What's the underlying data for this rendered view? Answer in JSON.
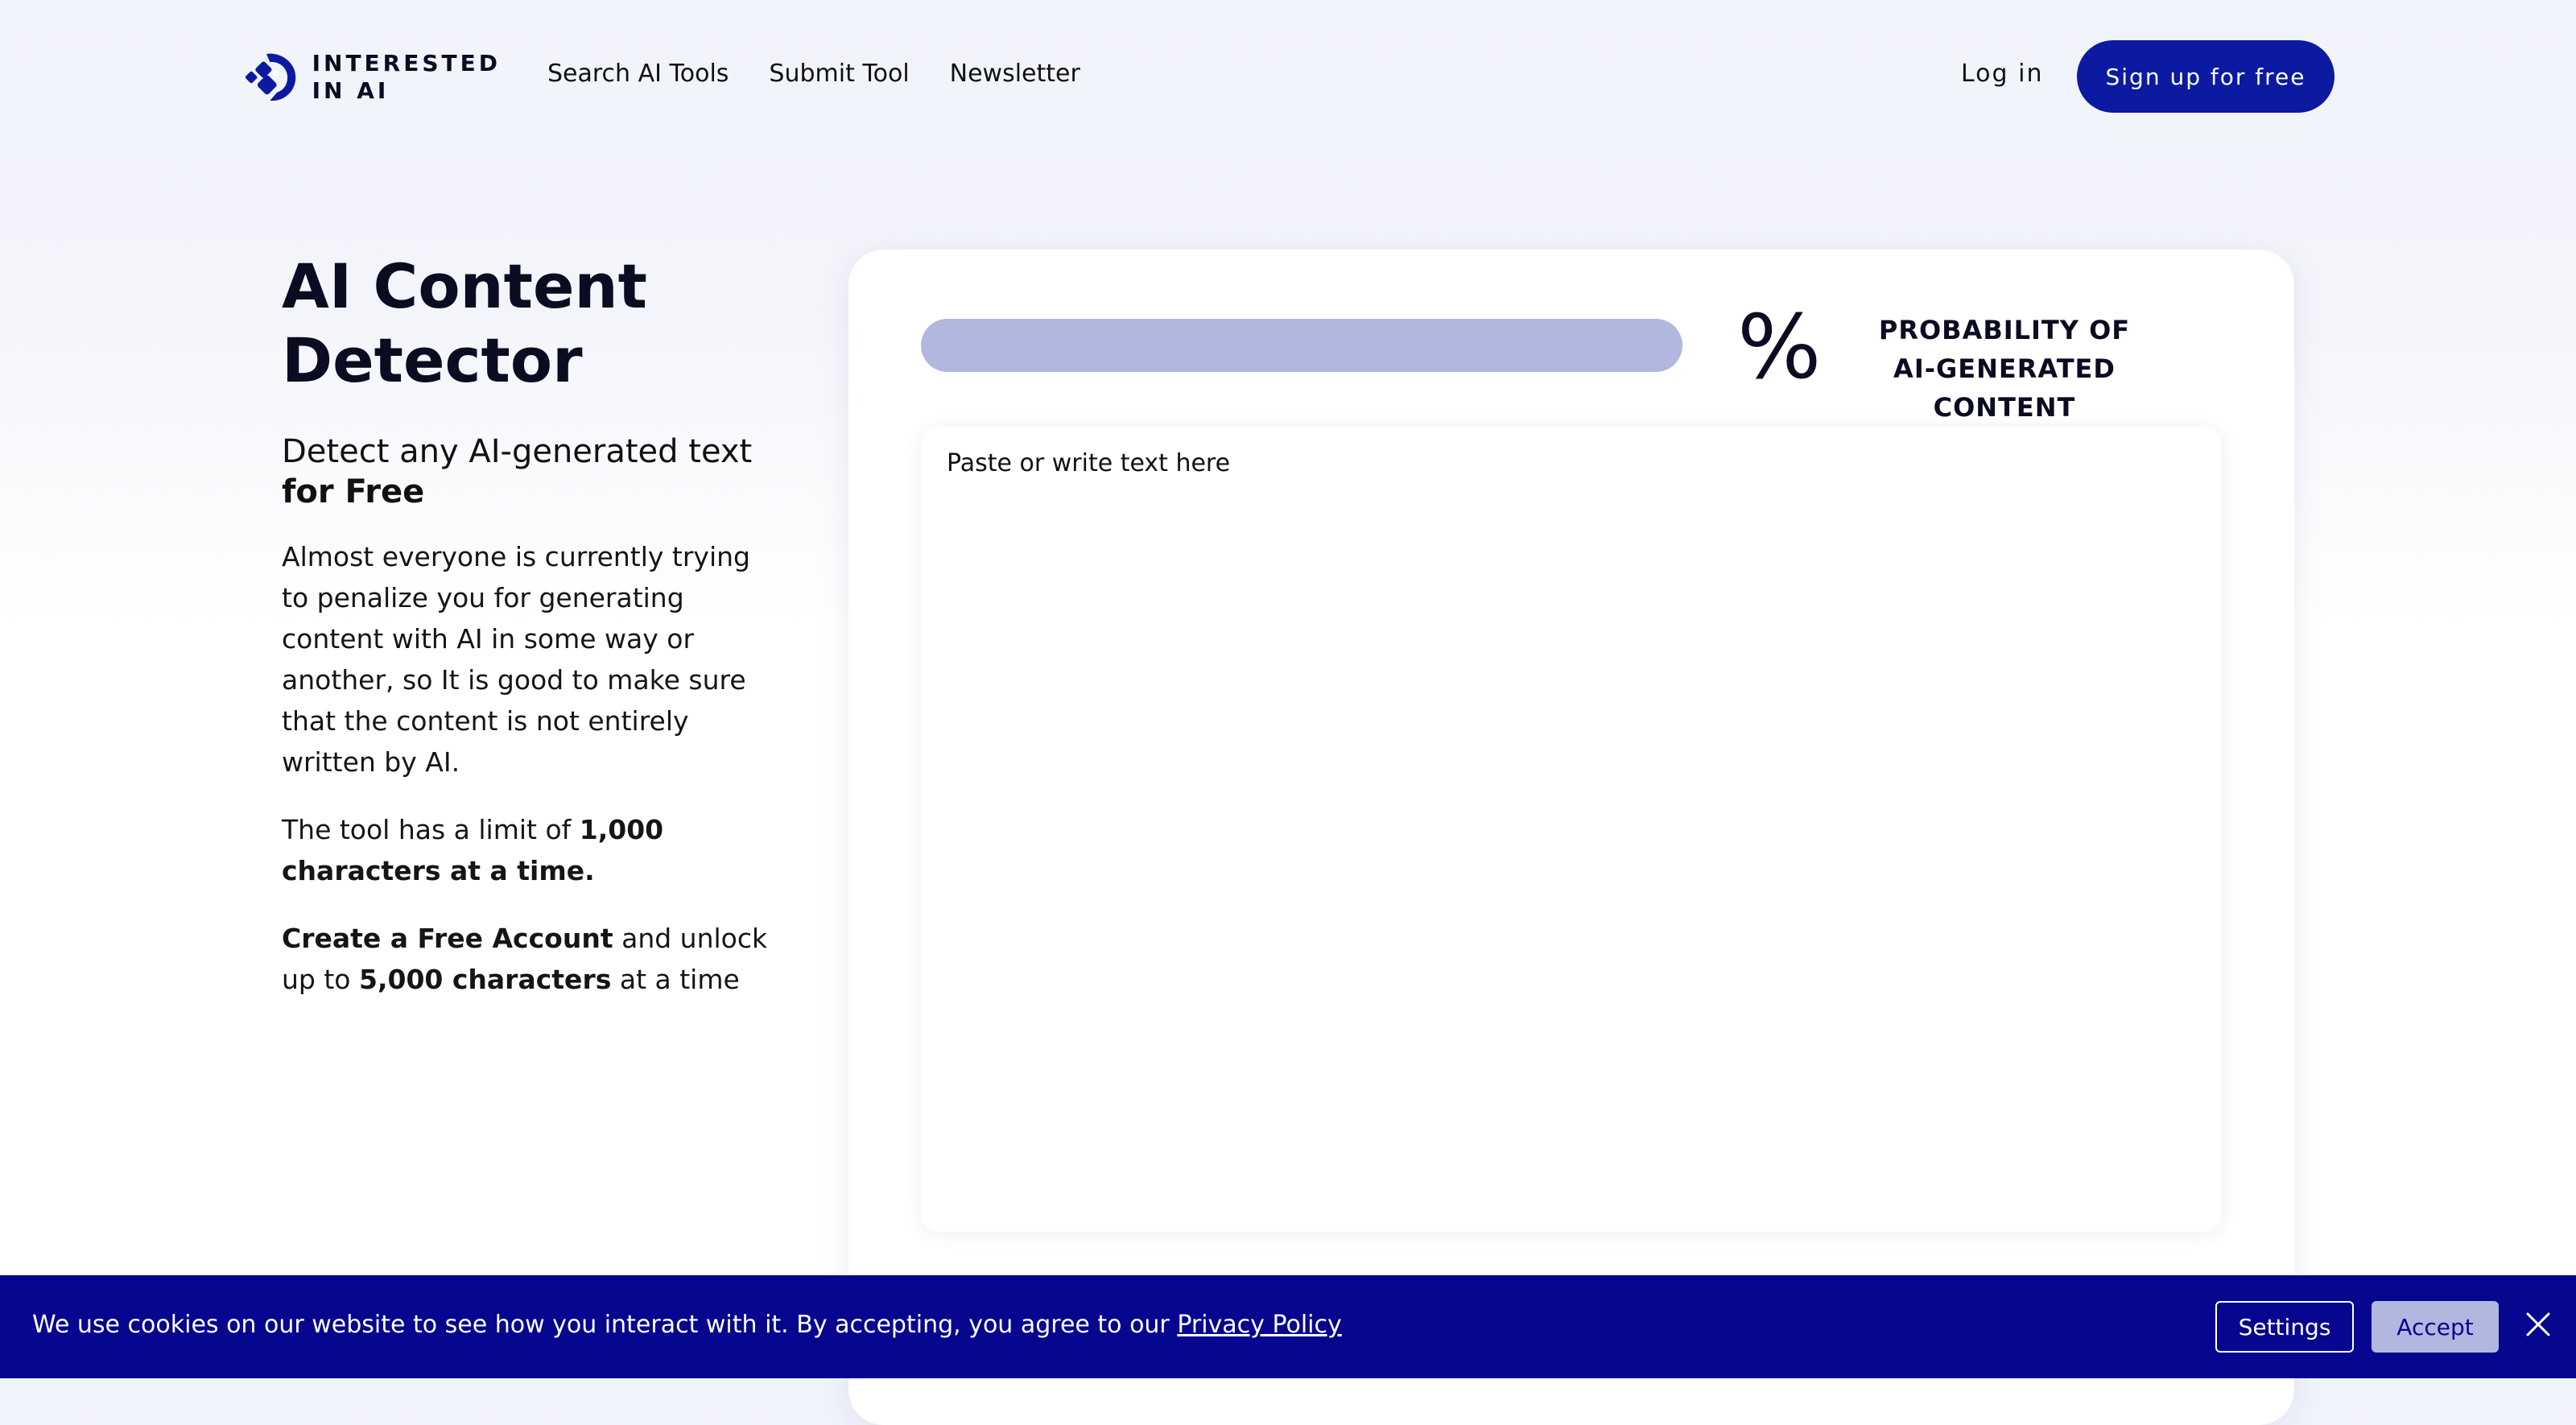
{
  "brand": {
    "line1": "INTERESTED",
    "line2": "IN AI",
    "color": "#0b1aa1"
  },
  "nav": {
    "items": [
      "Search AI Tools",
      "Submit Tool",
      "Newsletter"
    ]
  },
  "header": {
    "login_label": "Log in",
    "signup_label": "Sign up for free"
  },
  "hero": {
    "title": "AI Content Detector",
    "subtitle": "Detect any AI-generated text",
    "subtitle_strong": "for Free",
    "paragraph": "Almost everyone is currently trying to penalize you for generating content with AI in some way or another, so It is good to make sure that the content is not entirely written by AI.",
    "limit_prefix": "The tool has a limit of ",
    "limit_value": "1,000 characters at a time.",
    "account_strong": "Create a Free Account",
    "account_mid": " and unlock up to ",
    "account_value": "5,000 characters",
    "account_suffix": " at a time"
  },
  "detector": {
    "percent_symbol": "%",
    "label_line1": "PROBABILITY OF",
    "label_line2": "AI-GENERATED CONTENT",
    "progress_fraction": 0,
    "input_placeholder": "Paste or write text here"
  },
  "cookie": {
    "text": "We use cookies on our website to see how you interact with it. By accepting, you agree to our ",
    "policy_link": "Privacy Policy",
    "settings_label": "Settings",
    "accept_label": "Accept",
    "background": "#06068f"
  },
  "icons": {
    "close": "close-icon",
    "logo": "logo-icon"
  }
}
